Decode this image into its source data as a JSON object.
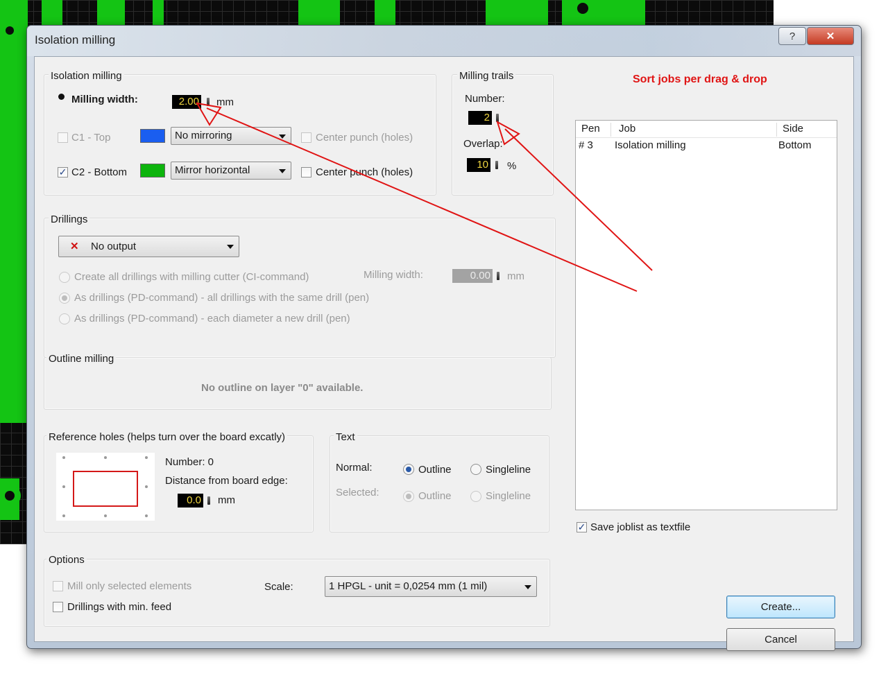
{
  "window": {
    "title": "Isolation milling",
    "help_label": "?",
    "close_label": "✕"
  },
  "isolation": {
    "title": "Isolation milling",
    "width_label": "Milling width:",
    "width_value": "2.00",
    "width_unit": "mm",
    "layers": [
      {
        "label": "C1 - Top",
        "checked": false,
        "color": "#1a5ef0",
        "mirror": "No mirroring",
        "punch_label": "Center punch (holes)"
      },
      {
        "label": "C2 - Bottom",
        "checked": true,
        "color": "#0db40d",
        "mirror": "Mirror horizontal",
        "punch_label": "Center punch (holes)"
      }
    ]
  },
  "trails": {
    "title": "Milling trails",
    "number_label": "Number:",
    "number_value": "2",
    "overlap_label": "Overlap:",
    "overlap_value": "10",
    "overlap_unit": "%"
  },
  "jobs": {
    "sort_label": "Sort jobs per drag & drop",
    "columns": [
      "Pen",
      "Job",
      "Side"
    ],
    "rows": [
      {
        "pen": "# 3",
        "job": "Isolation milling",
        "side": "Bottom"
      }
    ],
    "save_label": "Save joblist as textfile",
    "save_checked": true
  },
  "drillings": {
    "title": "Drillings",
    "output": "No output",
    "options": [
      "Create all drillings with milling cutter (CI-command)",
      "As drillings (PD-command) - all drillings with the same drill (pen)",
      "As drillings (PD-command) - each diameter a new drill (pen)"
    ],
    "selected_index": 1,
    "width_label": "Milling width:",
    "width_value": "0.00",
    "width_unit": "mm"
  },
  "outline": {
    "title": "Outline milling",
    "message": "No outline on layer \"0\" available."
  },
  "reference": {
    "title": "Reference holes (helps turn over the board excatly)",
    "number_label": "Number: 0",
    "distance_label": "Distance from board edge:",
    "distance_value": "0.0",
    "distance_unit": "mm"
  },
  "text": {
    "title": "Text",
    "normal_label": "Normal:",
    "selected_label": "Selected:",
    "outline_label": "Outline",
    "singleline_label": "Singleline"
  },
  "options": {
    "title": "Options",
    "mill_selected_label": "Mill only selected elements",
    "drill_min_feed_label": "Drillings with min. feed",
    "scale_label": "Scale:",
    "scale_value": "1 HPGL - unit = 0,0254 mm (1 mil)"
  },
  "buttons": {
    "create": "Create...",
    "cancel": "Cancel"
  },
  "colors": {
    "annotation": "#e01414",
    "pcb_copper": "#14c414"
  }
}
